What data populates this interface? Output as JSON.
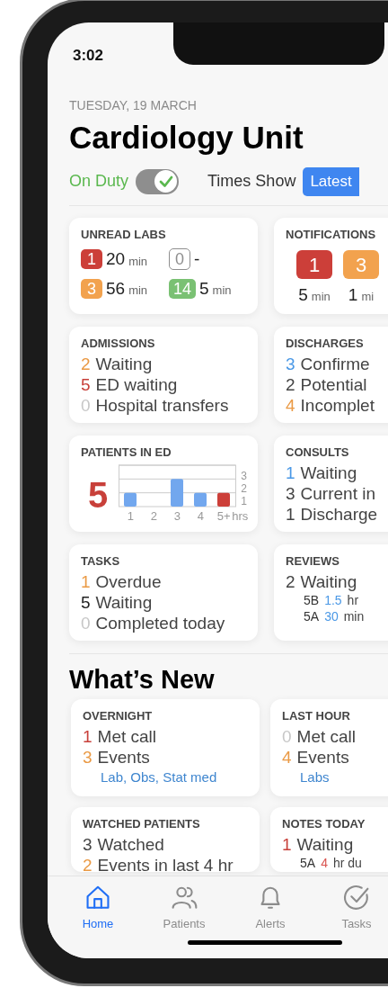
{
  "status_bar": {
    "time": "3:02"
  },
  "date": "TUESDAY, 19 MARCH",
  "title": "Cardiology Unit",
  "on_duty": {
    "label": "On Duty",
    "on": true
  },
  "times_show": {
    "label": "Times Show",
    "options": [
      {
        "label": "Latest",
        "selected": true
      }
    ]
  },
  "summary_cards": [
    {
      "kind": "labs",
      "title": "UNREAD LABS",
      "items": [
        {
          "count": "1",
          "color": "#cc3f39",
          "value": "20",
          "unit": "min"
        },
        {
          "count": "0",
          "color": "#8e8e8e",
          "outlined": true,
          "value": "-"
        },
        {
          "count": "3",
          "color": "#f2a24e",
          "value": "56",
          "unit": "min"
        },
        {
          "count": "14",
          "color": "#7ac173",
          "value": "5",
          "unit": "min"
        }
      ]
    },
    {
      "kind": "badges",
      "title": "NOTIFICATIONS",
      "items": [
        {
          "count": "1",
          "color": "#cc3f39",
          "value": "5",
          "unit": "min"
        },
        {
          "count": "3",
          "color": "#f2a24e",
          "value": "1",
          "unit": "mi"
        }
      ]
    },
    {
      "kind": "list",
      "title": "ADMISSIONS",
      "items": [
        {
          "count": "2",
          "color": "#ea9a45",
          "label": "Waiting"
        },
        {
          "count": "5",
          "color": "#c8403a",
          "label": "ED waiting"
        },
        {
          "count": "0",
          "color": "#c7c7c7",
          "label": "Hospital transfers"
        }
      ]
    },
    {
      "kind": "list",
      "title": "DISCHARGES",
      "items": [
        {
          "count": "3",
          "color": "#4a98e6",
          "label": "Confirme"
        },
        {
          "count": "2",
          "color": "#444444",
          "label": "Potential"
        },
        {
          "count": "4",
          "color": "#ea9a45",
          "label": "Incomplet"
        }
      ]
    },
    {
      "kind": "chart",
      "title": "PATIENTS IN ED",
      "count": "5",
      "chart_data": {
        "type": "bar",
        "xlabel": "hrs",
        "categories": [
          "1",
          "2",
          "3",
          "4",
          "5+"
        ],
        "values": [
          1,
          0,
          2,
          1,
          1
        ],
        "colors": [
          "#72a7ee",
          "#72a7ee",
          "#72a7ee",
          "#72a7ee",
          "#cc3f39"
        ],
        "ylim": [
          0,
          3
        ],
        "yticks": [
          1,
          2,
          3
        ]
      }
    },
    {
      "kind": "list",
      "title": "CONSULTS",
      "items": [
        {
          "count": "1",
          "color": "#4a98e6",
          "label": "Waiting"
        },
        {
          "count": "3",
          "color": "#444444",
          "label": "Current in"
        },
        {
          "count": "1",
          "color": "#444444",
          "label": "Discharge"
        }
      ]
    },
    {
      "kind": "list",
      "title": "TASKS",
      "items": [
        {
          "count": "1",
          "color": "#ea9a45",
          "label": "Overdue"
        },
        {
          "count": "5",
          "color": "#222222",
          "label": "Waiting"
        },
        {
          "count": "0",
          "color": "#c7c7c7",
          "label": "Completed today"
        }
      ]
    },
    {
      "kind": "list",
      "title": "REVIEWS",
      "items": [
        {
          "count": "2",
          "color": "#444444",
          "label": "Waiting"
        }
      ],
      "sub_rows": [
        {
          "ward": "5B",
          "value": "1.5",
          "color": "#4a98e6",
          "unit": "hr"
        },
        {
          "ward": "5A",
          "value": "30",
          "color": "#4a98e6",
          "unit": "min"
        }
      ]
    }
  ],
  "whats_new": {
    "title": "What’s New",
    "cards": [
      {
        "kind": "list",
        "title": "OVERNIGHT",
        "items": [
          {
            "count": "1",
            "color": "#c8403a",
            "label": "Met call"
          },
          {
            "count": "3",
            "color": "#ea9a45",
            "label": "Events"
          }
        ],
        "links": "Lab, Obs, Stat med"
      },
      {
        "kind": "list",
        "title": "LAST HOUR",
        "items": [
          {
            "count": "0",
            "color": "#c7c7c7",
            "label": "Met call"
          },
          {
            "count": "4",
            "color": "#ea9a45",
            "label": "Events"
          }
        ],
        "links": "Labs"
      },
      {
        "kind": "list",
        "title": "WATCHED PATIENTS",
        "items": [
          {
            "count": "3",
            "color": "#444444",
            "label": "Watched"
          },
          {
            "count": "2",
            "color": "#ea9a45",
            "label": "Events in last 4 hr"
          }
        ]
      },
      {
        "kind": "list",
        "title": "NOTES TODAY",
        "items": [
          {
            "count": "1",
            "color": "#c8403a",
            "label": "Waiting"
          }
        ],
        "sub_rows": [
          {
            "ward": "5A",
            "value": "4",
            "color": "#d9534f",
            "unit": "hr du"
          }
        ]
      }
    ]
  },
  "tab_bar": [
    {
      "kind": "home",
      "label": "Home",
      "selected": true
    },
    {
      "kind": "patients",
      "label": "Patients",
      "selected": false
    },
    {
      "kind": "alerts",
      "label": "Alerts",
      "selected": false
    },
    {
      "kind": "tasks",
      "label": "Tasks",
      "selected": false
    }
  ]
}
